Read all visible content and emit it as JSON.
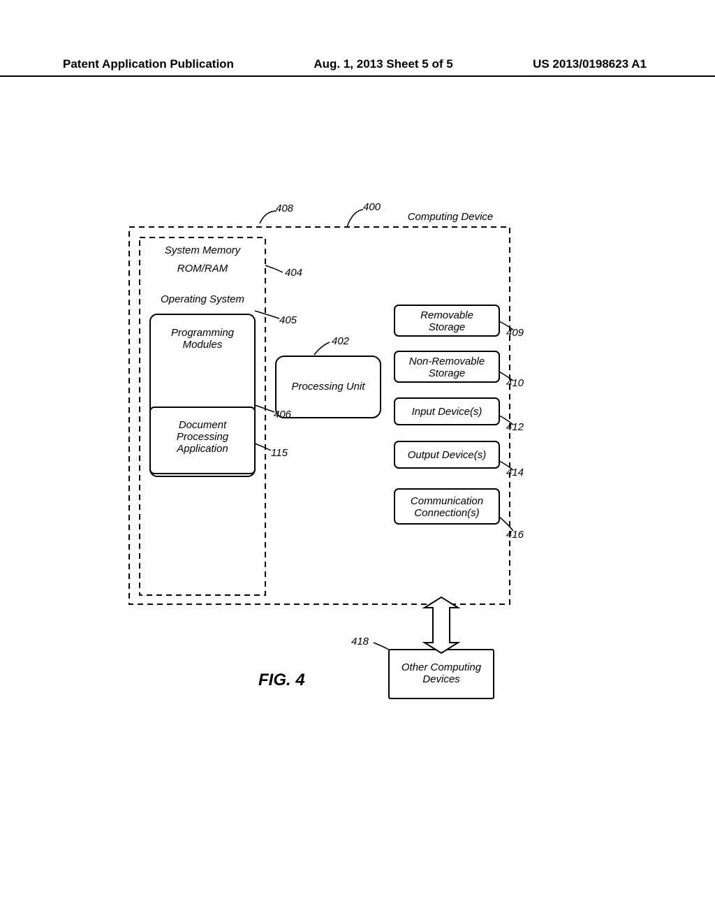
{
  "header": {
    "left": "Patent Application Publication",
    "center": "Aug. 1, 2013  Sheet 5 of 5",
    "right": "US 2013/0198623 A1"
  },
  "labels": {
    "computing_device": "Computing Device",
    "system_memory": "System Memory",
    "rom_ram": "ROM/RAM",
    "operating_system": "Operating System",
    "programming_modules": "Programming\nModules",
    "document_processing_application": "Document\nProcessing\nApplication",
    "processing_unit": "Processing Unit",
    "removable_storage": "Removable\nStorage",
    "non_removable_storage": "Non-Removable\nStorage",
    "input_devices": "Input Device(s)",
    "output_devices": "Output Device(s)",
    "communication_connections": "Communication\nConnection(s)",
    "other_computing_devices": "Other Computing\nDevices"
  },
  "refs": {
    "r400": "400",
    "r402": "402",
    "r404": "404",
    "r405": "405",
    "r406": "406",
    "r408": "408",
    "r409": "409",
    "r410": "410",
    "r412": "412",
    "r414": "414",
    "r416": "416",
    "r418": "418",
    "r115": "115"
  },
  "figure_caption": "FIG. 4"
}
